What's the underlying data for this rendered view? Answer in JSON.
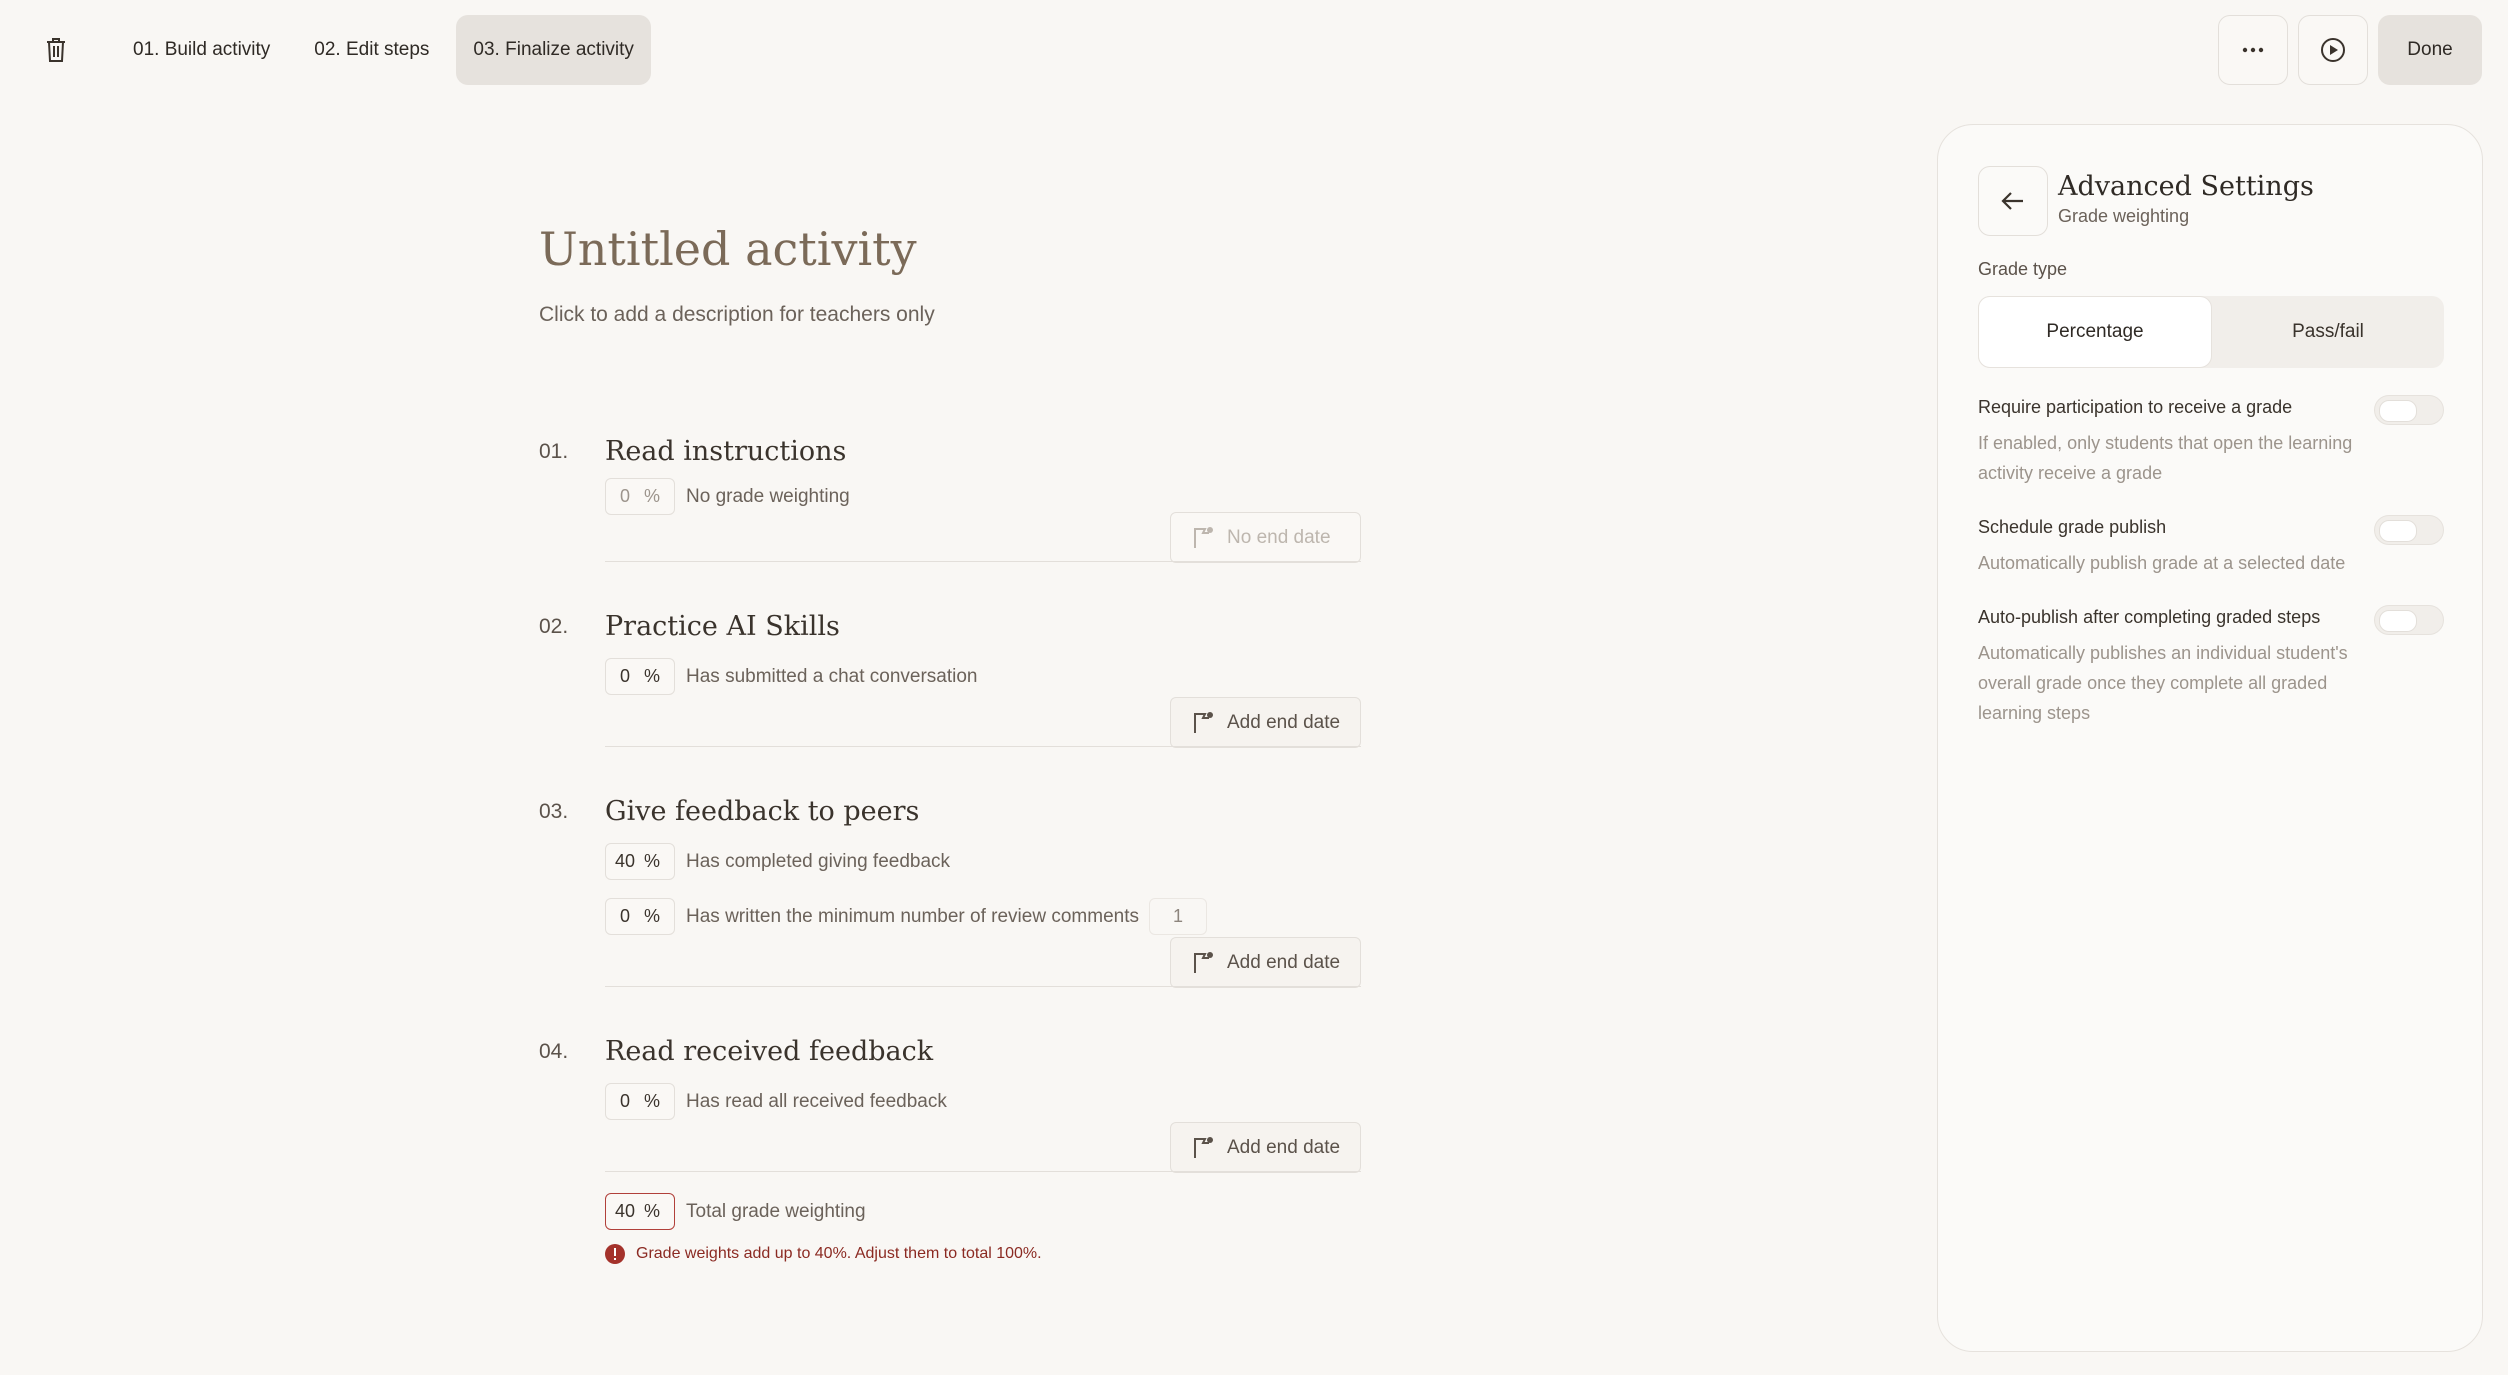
{
  "header": {
    "tabs": [
      {
        "label": "01. Build activity"
      },
      {
        "label": "02. Edit steps"
      },
      {
        "label": "03. Finalize activity"
      }
    ],
    "done_label": "Done"
  },
  "activity": {
    "title": "Untitled activity",
    "description_placeholder": "Click to add a description for teachers only"
  },
  "steps": [
    {
      "num": "01.",
      "title": "Read instructions",
      "rows": [
        {
          "value": "0",
          "unit": "%",
          "label": "No grade weighting"
        }
      ],
      "date_label": "No end date"
    },
    {
      "num": "02.",
      "title": "Practice AI Skills",
      "rows": [
        {
          "value": "0",
          "unit": "%",
          "label": "Has submitted a chat conversation"
        }
      ],
      "date_label": "Add end date"
    },
    {
      "num": "03.",
      "title": "Give feedback to peers",
      "rows": [
        {
          "value": "40",
          "unit": "%",
          "label": "Has completed giving feedback"
        },
        {
          "value": "0",
          "unit": "%",
          "label": "Has written the minimum number of review comments",
          "count": "1"
        }
      ],
      "date_label": "Add end date"
    },
    {
      "num": "04.",
      "title": "Read received feedback",
      "rows": [
        {
          "value": "0",
          "unit": "%",
          "label": "Has read all received feedback"
        }
      ],
      "date_label": "Add end date"
    }
  ],
  "total": {
    "value": "40",
    "unit": "%",
    "label": "Total grade weighting"
  },
  "error_message": "Grade weights add up to 40%. Adjust them to total 100%.",
  "panel": {
    "title": "Advanced Settings",
    "subtitle": "Grade weighting",
    "grade_type_label": "Grade type",
    "grade_type_options": [
      "Percentage",
      "Pass/fail"
    ],
    "grade_type_selected": "Percentage",
    "settings": [
      {
        "title": "Require participation to receive a grade",
        "description": "If enabled, only students that open the learning activity receive a grade",
        "enabled": false
      },
      {
        "title": "Schedule grade publish",
        "description": "Automatically publish grade at a selected date",
        "enabled": false
      },
      {
        "title": "Auto-publish after completing graded steps",
        "description": "Automatically publishes an individual student's overall grade once they complete all graded learning steps",
        "enabled": false
      }
    ]
  },
  "colors": {
    "background": "#f9f7f4",
    "accent_tab": "#e6e2dd",
    "error": "#b1403a"
  },
  "icons": [
    "trash-icon",
    "more-icon",
    "play-icon",
    "back-arrow-icon",
    "flag-check-icon",
    "error-icon"
  ]
}
